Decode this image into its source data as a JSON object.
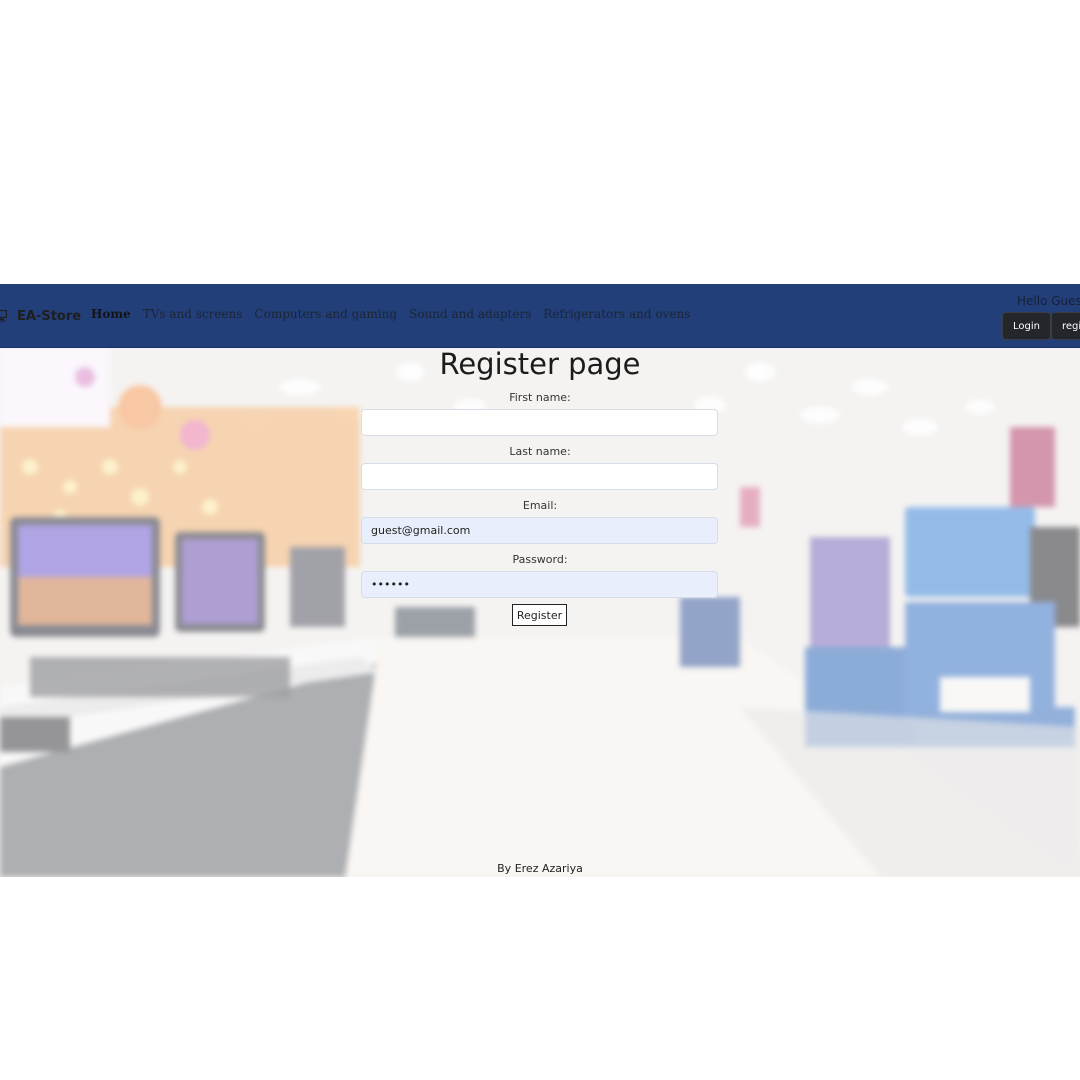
{
  "nav": {
    "brand": "EA-Store",
    "links": [
      "Home",
      "TVs and screens",
      "Computers and gaming",
      "Sound and adapters",
      "Refrigerators and ovens"
    ],
    "greeting": "Hello Gues",
    "login_label": "Login",
    "register_label": "regis"
  },
  "page": {
    "title": "Register page"
  },
  "form": {
    "first_name_label": "First name:",
    "first_name_value": "",
    "last_name_label": "Last name:",
    "last_name_value": "",
    "email_label": "Email:",
    "email_value": "guest@gmail.com",
    "password_label": "Password:",
    "password_value": "••••••",
    "submit_label": "Register"
  },
  "footer": {
    "credit": "By Erez Azariya"
  },
  "colors": {
    "navbar": "#223f7a",
    "auth_button": "#23262b",
    "filled_input": "#e8eefb"
  },
  "icons": {
    "brand": "computer-icon"
  }
}
